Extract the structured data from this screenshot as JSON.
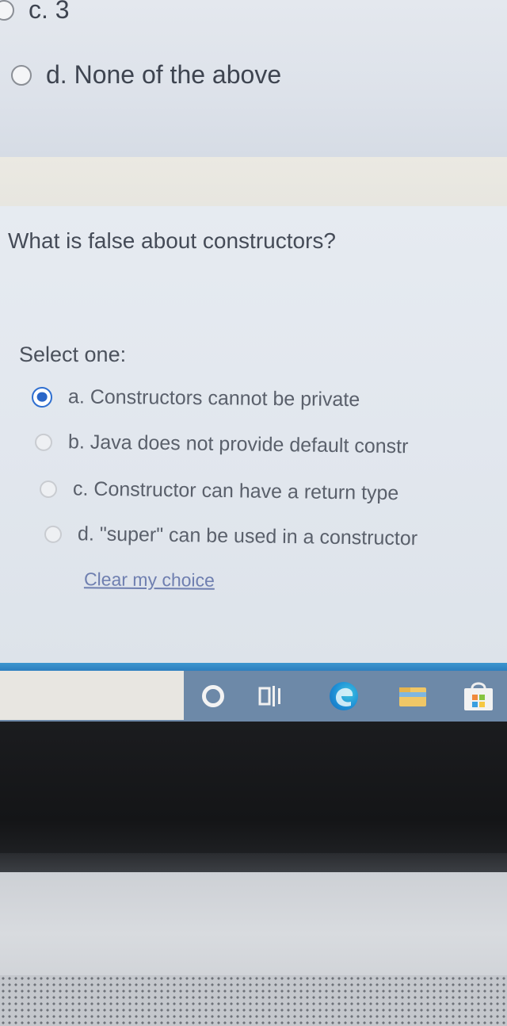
{
  "previous_question": {
    "options": [
      {
        "label": "c. 3",
        "selected": false
      },
      {
        "label": "d. None of the above",
        "selected": false
      }
    ]
  },
  "question": {
    "text": "What is false about constructors?",
    "select_label": "Select one:",
    "options": [
      {
        "label": "a. Constructors cannot be private",
        "selected": true
      },
      {
        "label": "b. Java does not provide default constr",
        "selected": false
      },
      {
        "label": "c. Constructor can have a return type",
        "selected": false
      },
      {
        "label": "d. \"super\" can be used in a constructor",
        "selected": false
      }
    ],
    "clear_label": "Clear my choice"
  },
  "taskbar": {
    "icons": [
      "cortana-icon",
      "task-view-icon",
      "edge-icon",
      "file-explorer-icon",
      "store-icon"
    ]
  },
  "colors": {
    "accent": "#2a66c8",
    "taskbar_line": "#3d95cf",
    "taskbar": "#6d89a8",
    "link": "#6f7fb0"
  }
}
